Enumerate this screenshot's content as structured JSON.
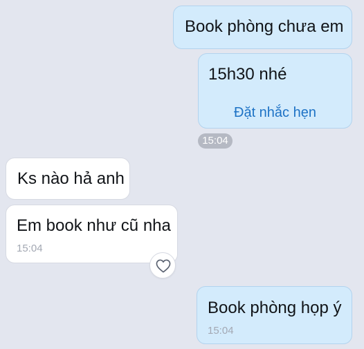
{
  "messages": [
    {
      "side": "sent",
      "text": "Book phòng chưa em"
    },
    {
      "side": "sent",
      "text": "15h30 nhé",
      "action_label": "Đặt nhắc hẹn"
    },
    {
      "side": "received",
      "text": "Ks nào hả anh"
    },
    {
      "side": "received",
      "text": "Em book như cũ nha",
      "time": "15:04"
    },
    {
      "side": "sent",
      "text": "Book phòng họp ý",
      "time": "15:04"
    }
  ],
  "time_chip": "15:04",
  "reaction_icon": "heart-icon",
  "colors": {
    "background": "#e3e6ef",
    "sent_bubble": "#d3ebfc",
    "received_bubble": "#ffffff",
    "link": "#1d72c5",
    "time_chip": "#b5b9c3"
  }
}
